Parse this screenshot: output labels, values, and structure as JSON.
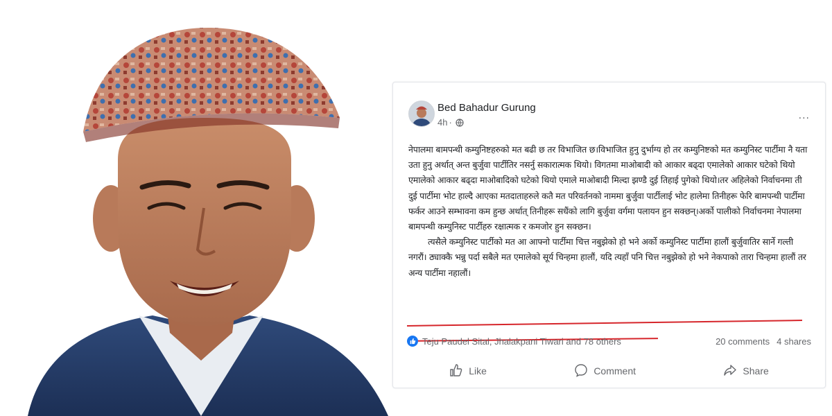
{
  "post": {
    "author": "Bed Bahadur Gurung",
    "time": "4h",
    "separator": "·",
    "more": "...",
    "body_p1": "नेपालमा बामपन्थी कम्युनिष्टहरुको मत बढी छ तर विभाजित छ।विभाजित हुनु दुर्भाग्य हो तर कम्युनिष्टको मत कम्युनिस्ट पार्टीमा नै यता उता हुनु अर्थात् अन्त बुर्जुवा पार्टीतिर नसर्नु सकारात्मक थियो। विगतमा माओबादी को आकार बढ्दा एमालेको आकार घटेको थियो एमालेको आकार बढ्दा माओबादिको घटेको थियो एमाले माओबादी मिल्दा झण्डै दुई तिहाई पुगेको थियो।तर अहिलेको निर्वाचनमा ती दुई पार्टीमा भोट हाल्दै आएका मतदाताहरुले कतै मत परिवर्तनको नाममा बुर्जुवा पार्टीलाई भोट हालेमा तिनीहरू फेरि बामपन्थी पार्टीमा फर्कर आउने सम्भावना कम हुन्छ अर्थात् तिनीहरू सधैंको लागि बुर्जुवा वर्गमा पलायन हुन सक्छन्।अर्को पालीको निर्वाचनमा नेपालमा बामपन्थी कम्युनिस्ट पार्टीहरु रक्षात्मक र कमजोर हुन सक्छन।",
    "body_p2": "त्यसैले कम्युनिस्ट पार्टीको मत आ आफ्नो पार्टीमा चित्त नबुझेको हो भने अर्को कम्युनिस्ट पार्टीमा हालौं बुर्जुवातिर सार्ने गल्ती नगरौं। ठ्याक्कै भन्नु पर्दा सबैले मत एमालेको सूर्य चिन्हमा हालौं, यदि त्यहाँ पनि चित्त नबुझेको हो भने नेकपाको तारा चिन्हमा हालौं तर अन्य पार्टीमा नहालौं।",
    "reactors": "Teju Paudel Sital, Jhalakpani Tiwari and 78 others",
    "comments": "20 comments",
    "shares": "4 shares",
    "actions": {
      "like": "Like",
      "comment": "Comment",
      "share": "Share"
    }
  },
  "colors": {
    "facebook_blue": "#1877f2",
    "underline_red": "#d6262b",
    "text_primary": "#1c1e21",
    "text_secondary": "#65676b"
  },
  "icons": [
    "globe-icon",
    "more-icon",
    "like-reaction-icon",
    "thumbs-up-icon",
    "comment-bubble-icon",
    "share-arrow-icon"
  ]
}
